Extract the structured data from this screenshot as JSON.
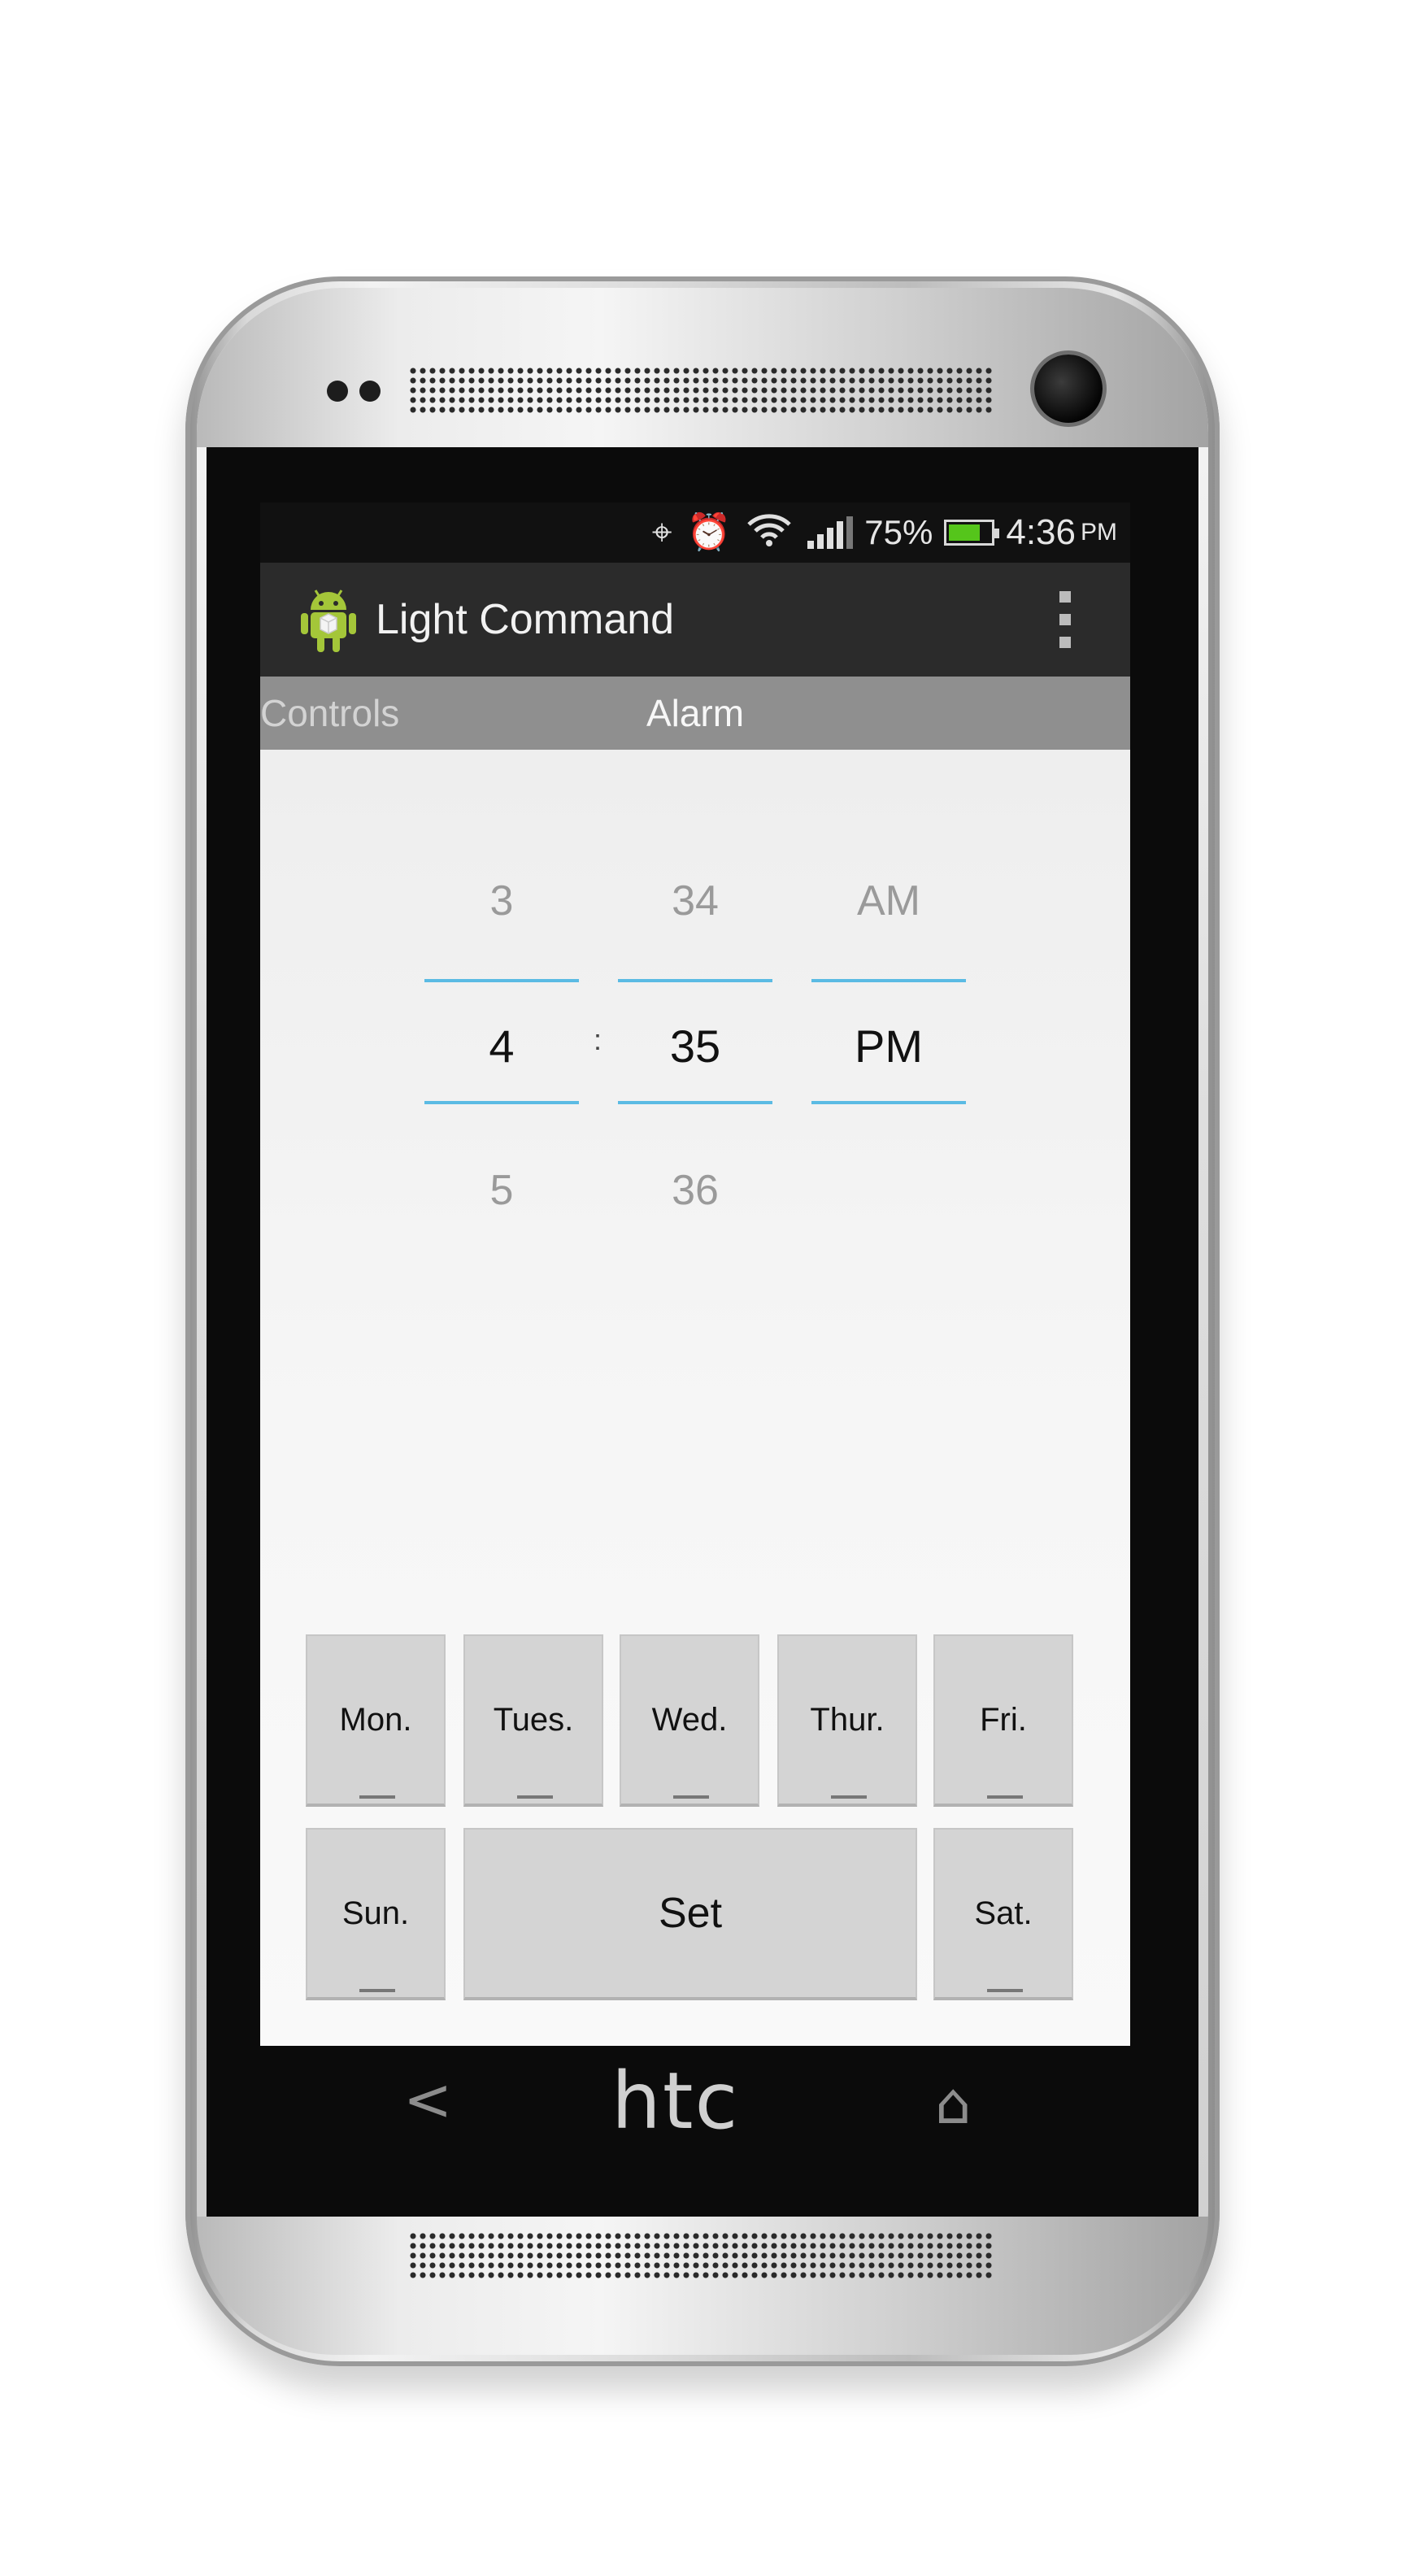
{
  "status_bar": {
    "icons": [
      "gps-icon",
      "alarm-clock-icon",
      "wifi-icon",
      "signal-icon"
    ],
    "battery_percent": "75%",
    "battery_level": 0.75,
    "time": "4:36",
    "ampm": "PM"
  },
  "action_bar": {
    "app_icon": "android-app-icon",
    "title": "Light Command",
    "overflow_icon": "overflow-menu-icon"
  },
  "tabs": {
    "controls": "Controls",
    "alarm": "Alarm",
    "selected": "Alarm"
  },
  "time_picker": {
    "hour": {
      "prev": "3",
      "current": "4",
      "next": "5"
    },
    "separator": ":",
    "minute": {
      "prev": "34",
      "current": "35",
      "next": "36"
    },
    "ampm": {
      "prev": "AM",
      "current": "PM"
    },
    "accent_color": "#5bbbe4"
  },
  "days": {
    "mon": "Mon.",
    "tue": "Tues.",
    "wed": "Wed.",
    "thu": "Thur.",
    "fri": "Fri.",
    "sun": "Sun.",
    "sat": "Sat."
  },
  "set_button": "Set",
  "device": {
    "brand": "htc",
    "nav_back": "<",
    "nav_home": "⌂"
  }
}
